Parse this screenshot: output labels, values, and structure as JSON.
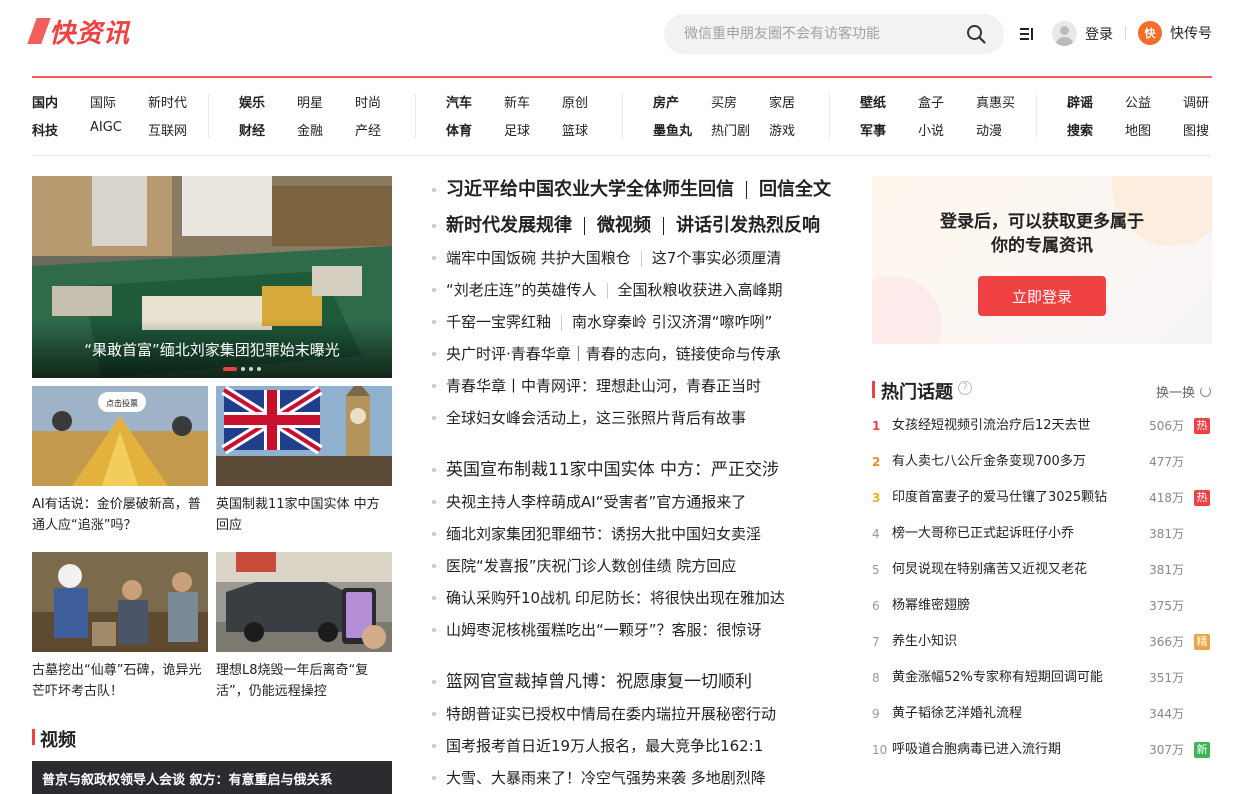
{
  "header": {
    "logo": "快资讯",
    "search_placeholder": "微信重申朋友圈不会有访客功能",
    "login": "登录",
    "kuaizixun_hao": "快传号",
    "kzh_icon_text": "快"
  },
  "nav": [
    {
      "rows": [
        [
          "国内",
          "国际",
          "新时代"
        ],
        [
          "科技",
          "AIGC",
          "互联网"
        ]
      ]
    },
    {
      "rows": [
        [
          "娱乐",
          "明星",
          "时尚"
        ],
        [
          "财经",
          "金融",
          "产经"
        ]
      ]
    },
    {
      "rows": [
        [
          "汽车",
          "新车",
          "原创"
        ],
        [
          "体育",
          "足球",
          "篮球"
        ]
      ]
    },
    {
      "rows": [
        [
          "房产",
          "买房",
          "家居"
        ],
        [
          "墨鱼丸",
          "热门剧",
          "游戏"
        ]
      ]
    },
    {
      "rows": [
        [
          "壁纸",
          "盒子",
          "真惠买"
        ],
        [
          "军事",
          "小说",
          "动漫"
        ]
      ]
    },
    {
      "rows": [
        [
          "辟谣",
          "公益",
          "调研"
        ],
        [
          "搜索",
          "地图",
          "图搜"
        ]
      ]
    }
  ],
  "hero": {
    "title": "“果敢首富”缅北刘家集团犯罪始末曝光"
  },
  "cards": [
    {
      "title": "AI有话说：金价屡破新高，普通人应“追涨”吗？",
      "badge": "点击投票"
    },
    {
      "title": "英国制裁11家中国实体 中方回应"
    },
    {
      "title": "古墓挖出“仙尊”石碑，诡异光芒吓坏考古队！"
    },
    {
      "title": "理想L8烧毁一年后离奇“复活”，仍能远程操控"
    }
  ],
  "video_section": {
    "title": "视频",
    "first_video": "普京与叙政权领导人会谈 叙方：有意重启与俄关系"
  },
  "news_blocks": [
    {
      "rows": [
        {
          "big": true,
          "parts": [
            "习近平给中国农业大学全体师生回信",
            "回信全文"
          ]
        },
        {
          "big": true,
          "parts": [
            "新时代发展规律",
            "微视频",
            "讲话引发热烈反响"
          ]
        },
        {
          "parts": [
            "端牢中国饭碗 共护大国粮仓",
            "这7个事实必须厘清"
          ]
        },
        {
          "parts": [
            "“刘老庄连”的英雄传人",
            "全国秋粮收获进入高峰期"
          ]
        },
        {
          "parts": [
            "千窑一宝霁红釉",
            "南水穿秦岭 引汉济渭“嚓咋咧”"
          ]
        },
        {
          "parts": [
            "央广时评·青春华章｜青春的志向，链接使命与传承"
          ]
        },
        {
          "parts": [
            "青春华章丨中青网评：理想赴山河，青春正当时"
          ]
        },
        {
          "parts": [
            "全球妇女峰会活动上，这三张照片背后有故事"
          ]
        }
      ]
    },
    {
      "rows": [
        {
          "parts": [
            "英国宣布制裁11家中国实体 中方：严正交涉"
          ],
          "lead": true
        },
        {
          "parts": [
            "央视主持人李梓萌成AI“受害者”官方通报来了"
          ]
        },
        {
          "parts": [
            "缅北刘家集团犯罪细节：诱拐大批中国妇女卖淫"
          ]
        },
        {
          "parts": [
            "医院“发喜报”庆祝门诊人数创佳绩 院方回应"
          ]
        },
        {
          "parts": [
            "确认采购歼10战机 印尼防长：将很快出现在雅加达"
          ]
        },
        {
          "parts": [
            "山姆枣泥核桃蛋糕吃出“一颗牙”？客服：很惊讶"
          ]
        }
      ]
    },
    {
      "rows": [
        {
          "parts": [
            "篮网官宣裁掉曾凡博：祝愿康复一切顺利"
          ],
          "lead": true
        },
        {
          "parts": [
            "特朗普证实已授权中情局在委内瑞拉开展秘密行动"
          ]
        },
        {
          "parts": [
            "国考报考首日近19万人报名，最大竞争比162:1"
          ]
        },
        {
          "parts": [
            "大雪、大暴雨来了！冷空气强势来袭 多地剧烈降"
          ]
        }
      ]
    }
  ],
  "login_box": {
    "line1": "登录后，可以获取更多属于",
    "line2": "你的专属资讯",
    "button": "立即登录"
  },
  "hot": {
    "title": "热门话题",
    "refresh": "换一换",
    "items": [
      {
        "rank": "1",
        "title": "女孩经短视频引流治疗后12天去世",
        "count": "506万",
        "tag": "热",
        "tag_color": "#f04142"
      },
      {
        "rank": "2",
        "title": "有人卖七八公斤金条变现700多万",
        "count": "477万"
      },
      {
        "rank": "3",
        "title": "印度首富妻子的爱马仕镶了3025颗钻",
        "count": "418万",
        "tag": "热",
        "tag_color": "#f04142"
      },
      {
        "rank": "4",
        "title": "榜一大哥称已正式起诉旺仔小乔",
        "count": "381万"
      },
      {
        "rank": "5",
        "title": "何炅说现在特别痛苦又近视又老花",
        "count": "381万"
      },
      {
        "rank": "6",
        "title": "杨幂维密翅膀",
        "count": "375万"
      },
      {
        "rank": "7",
        "title": "养生小知识",
        "count": "366万",
        "tag": "精",
        "tag_color": "#e9a545"
      },
      {
        "rank": "8",
        "title": "黄金涨幅52%专家称有短期回调可能",
        "count": "351万"
      },
      {
        "rank": "9",
        "title": "黄子韬徐艺洋婚礼流程",
        "count": "344万"
      },
      {
        "rank": "10",
        "title": "呼吸道合胞病毒已进入流行期",
        "count": "307万",
        "tag": "新",
        "tag_color": "#3db557"
      }
    ]
  },
  "colors": {
    "brand": "#f04142",
    "hot_tag": "#f04142",
    "fine_tag": "#e9a545",
    "new_tag": "#3db557"
  }
}
